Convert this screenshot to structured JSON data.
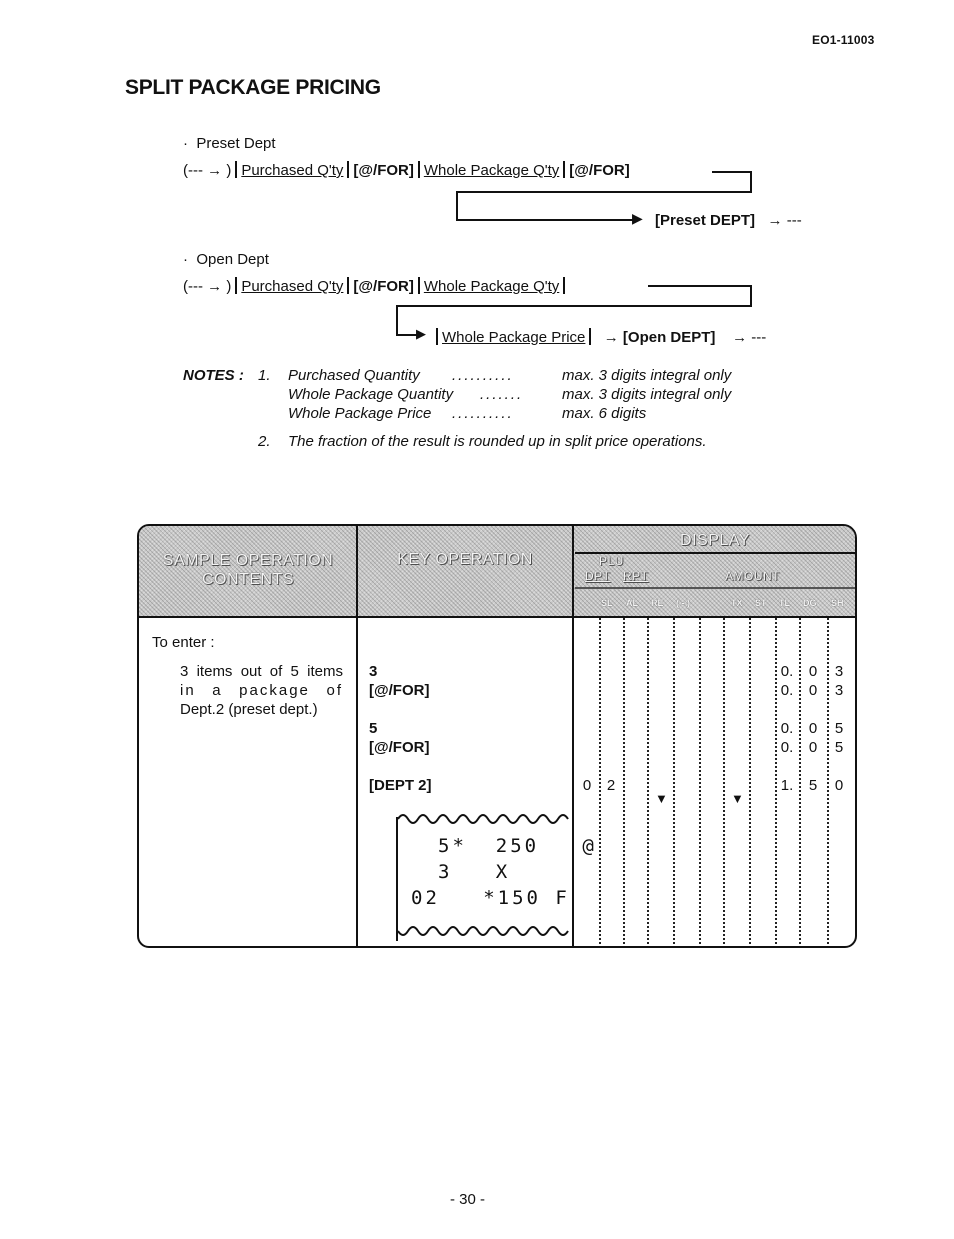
{
  "document_id": "EO1-11003",
  "title": "SPLIT PACKAGE PRICING",
  "preset_dept": {
    "heading": "Preset Dept",
    "start": "(---",
    "start_close": ")",
    "steps": [
      "Purchased Q'ty",
      "[@/FOR]",
      "Whole Package Q'ty",
      "[@/FOR]"
    ],
    "end_key": "[Preset DEPT]",
    "end": "---"
  },
  "open_dept": {
    "heading": "Open Dept",
    "start": "(---",
    "start_close": ")",
    "steps": [
      "Purchased Q'ty",
      "[@/FOR]",
      "Whole Package Q'ty"
    ],
    "price_step": "Whole Package Price",
    "end_key": "[Open DEPT]",
    "end": "---"
  },
  "notes": {
    "label": "NOTES :",
    "items": [
      {
        "num": "1.",
        "rows": [
          {
            "name": "Purchased Quantity",
            "leader": "..........",
            "limit": "max. 3 digits integral only"
          },
          {
            "name": "Whole Package Quantity",
            "leader": ".......",
            "limit": "max. 3 digits integral only"
          },
          {
            "name": "Whole Package Price",
            "leader": "..........",
            "limit": "max. 6 digits"
          }
        ]
      },
      {
        "num": "2.",
        "text": "The fraction of the result is rounded up in split price operations."
      }
    ]
  },
  "table": {
    "headers": {
      "sample_line1": "SAMPLE OPERATION",
      "sample_line2": "CONTENTS",
      "key_operation": "KEY OPERATION",
      "display": "DISPLAY",
      "plu": "PLU",
      "dpt": "DPT",
      "rpt": "RPT",
      "amount": "AMOUNT",
      "indicators": [
        "SL",
        "AL",
        "RE",
        "( - )",
        "TX",
        "ST",
        "TL",
        "DG",
        "SH"
      ]
    },
    "sample": {
      "intro": "To enter :",
      "lines": [
        "3 items out of 5 items",
        "in a package of",
        "Dept.2 (preset dept.)"
      ]
    },
    "key_ops": [
      "3",
      "[@/FOR]",
      "5",
      "[@/FOR]",
      "[DEPT 2]"
    ],
    "display_rows": [
      {
        "dept": [
          "",
          ""
        ],
        "amount": [
          "0.",
          "0",
          "3"
        ],
        "triangles": false
      },
      {
        "dept": [
          "",
          ""
        ],
        "amount": [
          "0.",
          "0",
          "3"
        ],
        "triangles": false
      },
      {
        "dept": [
          "",
          ""
        ],
        "amount": [
          "0.",
          "0",
          "5"
        ],
        "triangles": false
      },
      {
        "dept": [
          "",
          ""
        ],
        "amount": [
          "0.",
          "0",
          "5"
        ],
        "triangles": false
      },
      {
        "dept": [
          "0",
          "2"
        ],
        "amount": [
          "1.",
          "5",
          "0"
        ],
        "triangles": true
      }
    ],
    "triangle_glyph": "▼",
    "receipt": {
      "lines": [
        "5*  250   @",
        "3   X",
        "02   *150 F"
      ]
    }
  },
  "page_number": "- 30 -"
}
